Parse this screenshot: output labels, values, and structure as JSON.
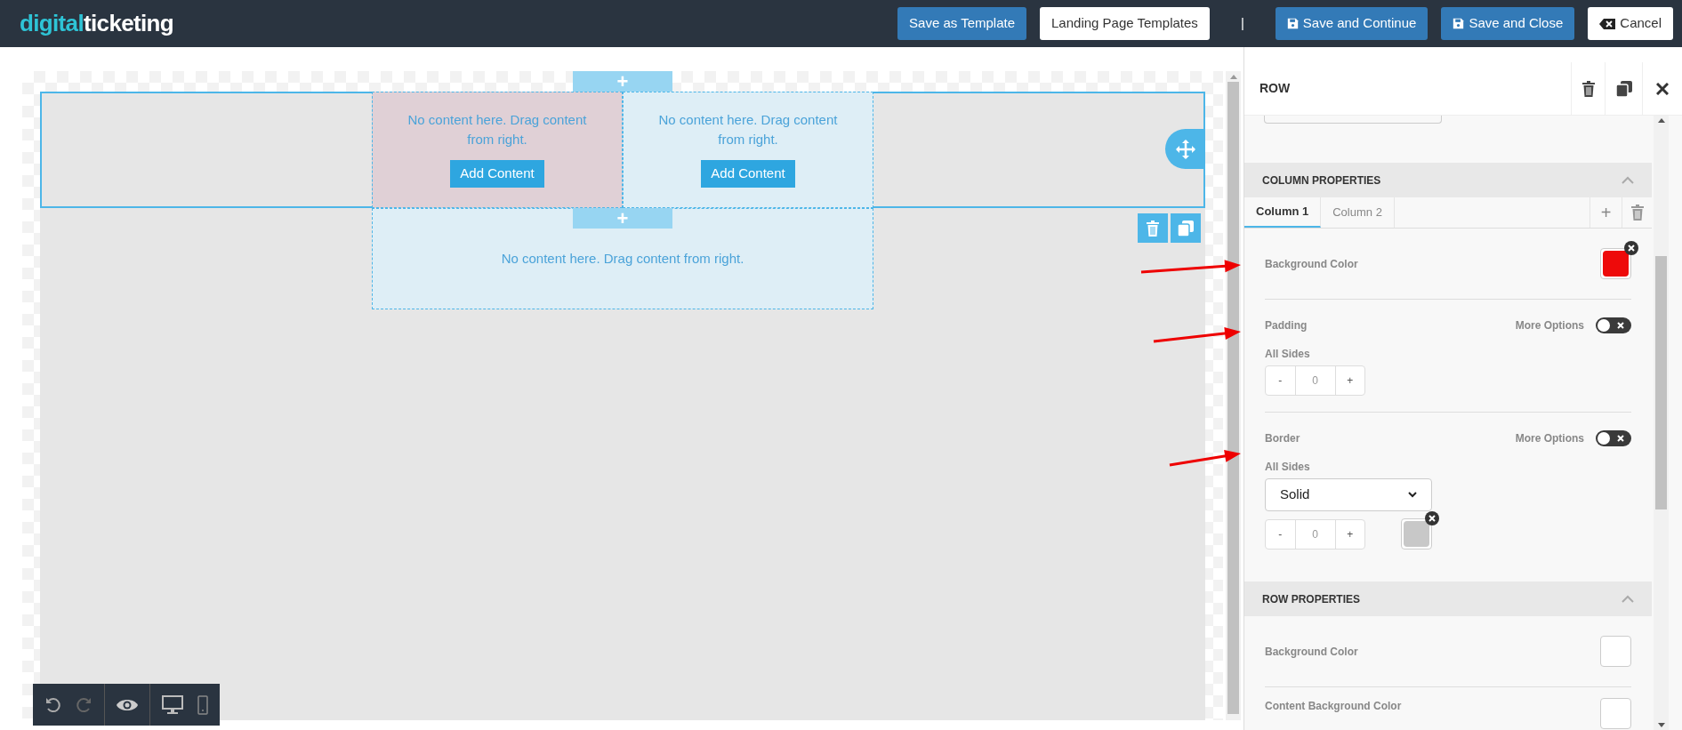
{
  "header": {
    "logo": {
      "first": "digital",
      "second": "ticketing"
    },
    "actions": [
      {
        "kind": "primary",
        "label": "Save as Template"
      },
      {
        "kind": "default",
        "label": "Landing Page Templates"
      },
      {
        "kind": "separator",
        "label": "|"
      },
      {
        "kind": "save",
        "label": "Save and Continue"
      },
      {
        "kind": "save",
        "label": "Save and Close"
      },
      {
        "kind": "cancel",
        "label": "Cancel"
      }
    ]
  },
  "canvas": {
    "add_above": "+",
    "add_below": "+",
    "columns": [
      {
        "text": "No content here. Drag content from right.",
        "button": "Add Content",
        "color": "#e0d0d6"
      },
      {
        "text": "No content here. Drag content from right.",
        "button": "Add Content",
        "color": "#deeef6"
      }
    ],
    "drop_zone": "No content here. Drag content from right."
  },
  "panel": {
    "title": "ROW",
    "column_properties": {
      "title": "COLUMN PROPERTIES",
      "add": "+",
      "tabs": [
        {
          "label": "Column 1",
          "selected": true
        },
        {
          "label": "Column 2",
          "selected": false
        }
      ],
      "background_color": {
        "label": "Background Color",
        "color": "#ee0a0a"
      },
      "padding": {
        "label": "Padding",
        "more_options": "More Options",
        "on": false,
        "sides": "All Sides",
        "minus": "-",
        "value": "0",
        "plus": "+"
      },
      "border": {
        "label": "Border",
        "more_options": "More Options",
        "on": false,
        "sides": "All Sides",
        "style": "Solid",
        "minus": "-",
        "value": "0",
        "plus": "+",
        "color": "#c8c8c8"
      }
    },
    "row_properties": {
      "title": "ROW PROPERTIES",
      "background_color": {
        "label": "Background Color",
        "color": "#ffffff"
      },
      "content_background_color": {
        "label": "Content Background Color",
        "color": "#ffffff"
      }
    }
  }
}
